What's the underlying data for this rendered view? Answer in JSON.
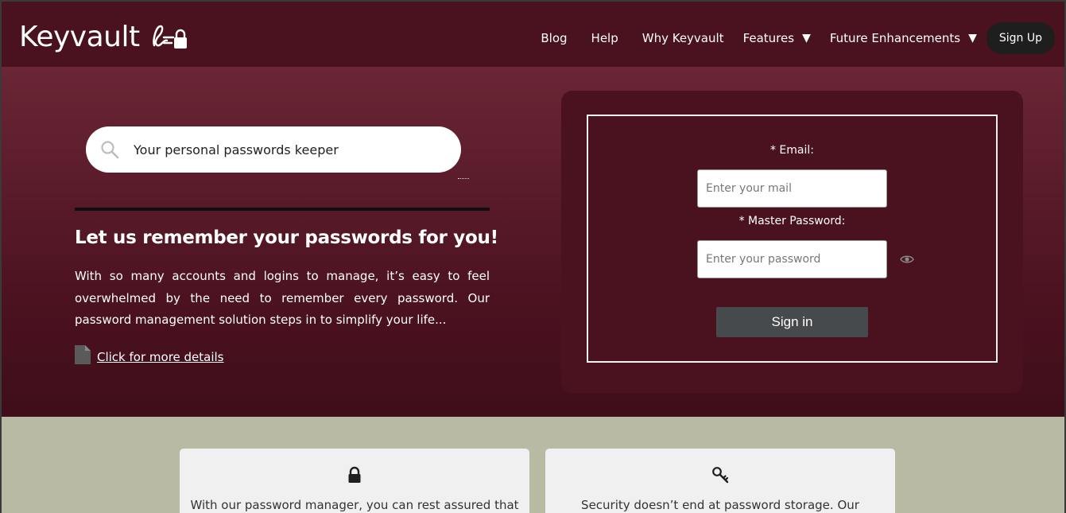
{
  "brand": {
    "name": "Keyvault"
  },
  "nav": {
    "items": [
      {
        "label": "Blog"
      },
      {
        "label": "Help"
      },
      {
        "label": "Why Keyvault"
      },
      {
        "label": "Features"
      },
      {
        "label": "Future Enhancements"
      }
    ],
    "signup_label": "Sign Up"
  },
  "hero": {
    "search_text": "Your personal passwords keeper",
    "title": "Let us remember your passwords for you!",
    "body": "With so many accounts and logins to manage, it’s easy to feel overwhelmed by the need to remember every password. Our password management solution steps in to simplify your life...",
    "details_link": " Click for more details"
  },
  "login": {
    "email_label": "* Email:",
    "email_placeholder": "Enter your mail",
    "password_label": "* Master Password:",
    "password_placeholder": "Enter your password",
    "signin_label": "Sign in"
  },
  "features": [
    {
      "icon": "lock-icon",
      "text": "With our password manager, you can rest assured that"
    },
    {
      "icon": "key-icon",
      "text": "Security doesn’t end at password storage. Our"
    }
  ],
  "colors": {
    "header_bg": "#4a111f",
    "hero_top": "#6a2635",
    "features_bg": "#b8baa4",
    "signin_bg": "#474a4d"
  }
}
